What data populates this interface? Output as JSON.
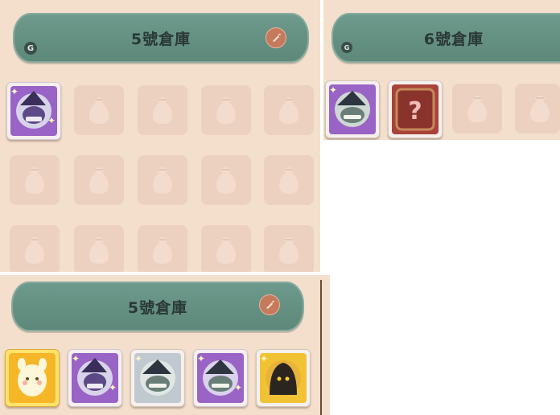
{
  "panels": [
    {
      "banner_title": "5號倉庫",
      "badge": "G"
    },
    {
      "banner_title": "6號倉庫",
      "badge": "G"
    },
    {
      "banner_title": "5號倉庫"
    }
  ],
  "icons": {
    "empty_slot": "money-bag-icon",
    "edit": "carrot-pencil-icon",
    "unknown": "question-mark-icon"
  },
  "colors": {
    "panel_bg": "#f3dfcc",
    "banner": "#6a9788",
    "empty_slot": "#ecd1c0",
    "rarity_purple": "#9a63c6",
    "rarity_gold": "#f5b627",
    "rarity_red": "#a9433a"
  }
}
